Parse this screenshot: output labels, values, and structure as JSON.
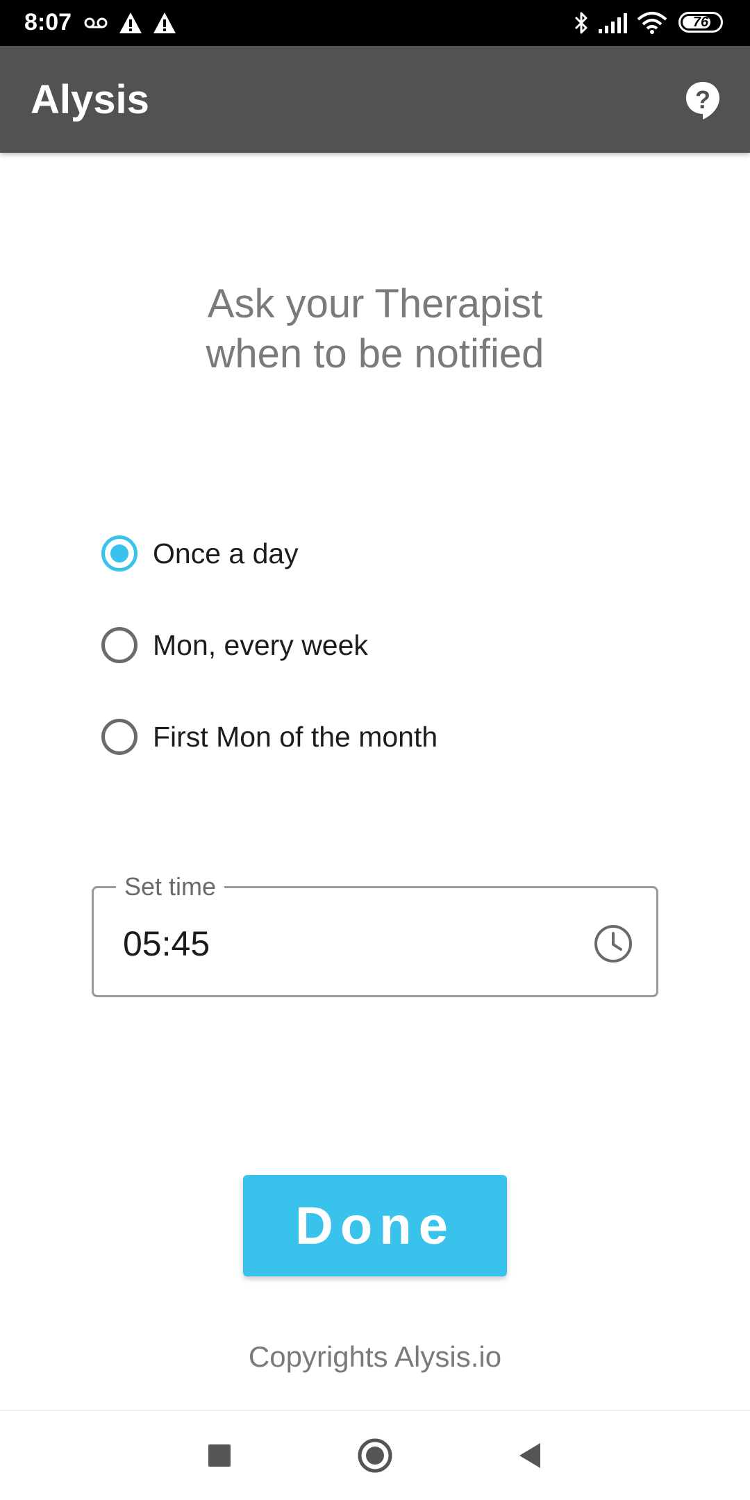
{
  "status_bar": {
    "time": "8:07",
    "battery": "76",
    "battery_level_percent": 76,
    "icons": [
      "voicemail-icon",
      "alert-icon",
      "alert-icon",
      "bluetooth-icon",
      "signal-icon",
      "wifi-icon",
      "battery-icon"
    ]
  },
  "app_bar": {
    "title": "Alysis",
    "help_icon": "help-icon",
    "background_color": "#525252"
  },
  "heading": {
    "line1": "Ask your Therapist",
    "line2": "when to be notified"
  },
  "frequency_options": {
    "selected_index": 0,
    "items": [
      {
        "label": "Once a day",
        "checked": true
      },
      {
        "label": "Mon, every week",
        "checked": false
      },
      {
        "label": "First Mon of the month",
        "checked": false
      }
    ]
  },
  "time_field": {
    "label": "Set time",
    "value": "05:45",
    "icon": "clock-icon"
  },
  "done_button": {
    "label": "Done",
    "color": "#39c3ec"
  },
  "footer": {
    "copyright": "Copyrights Alysis.io"
  },
  "nav_bar": {
    "buttons": [
      "recents-icon",
      "home-icon",
      "back-icon"
    ]
  },
  "colors": {
    "accent": "#39c3ec",
    "heading_text": "#7a7a7a"
  }
}
